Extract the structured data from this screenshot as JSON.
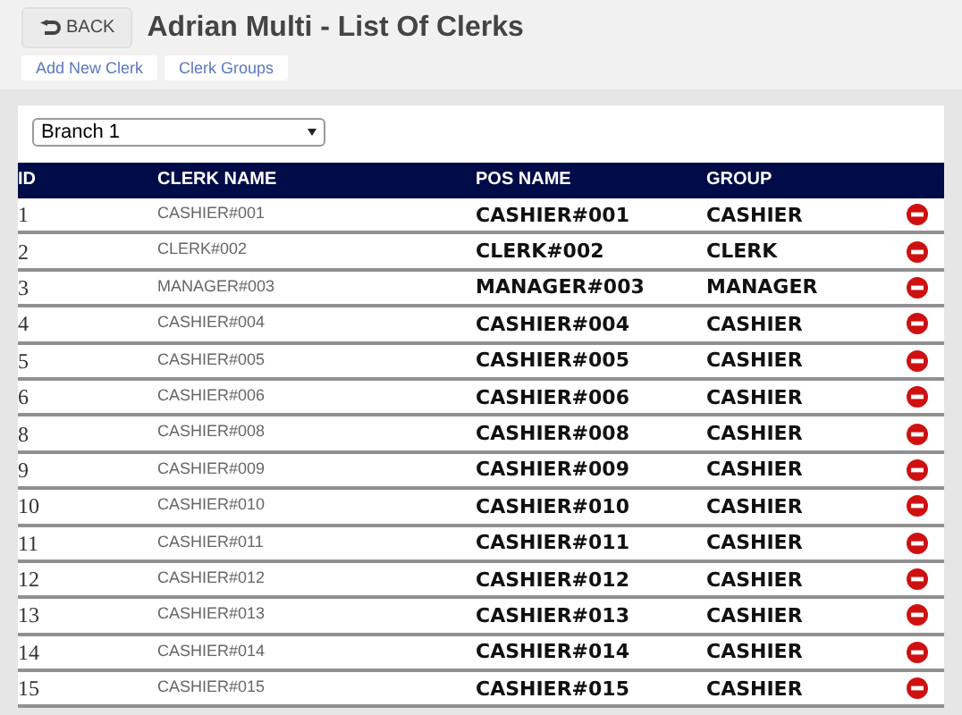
{
  "header": {
    "back_button": "BACK",
    "title": "Adrian Multi - List Of Clerks",
    "buttons": [
      "Add New Clerk",
      "Clerk Groups"
    ]
  },
  "branch_select": {
    "value": "Branch 1"
  },
  "table": {
    "columns": [
      "ID",
      "CLERK NAME",
      "POS NAME",
      "GROUP"
    ],
    "rows": [
      {
        "id": "1",
        "clerk_name": "CASHIER#001",
        "pos_name": "CASHIER#001",
        "group": "CASHIER"
      },
      {
        "id": "2",
        "clerk_name": "CLERK#002",
        "pos_name": "CLERK#002",
        "group": "CLERK"
      },
      {
        "id": "3",
        "clerk_name": "MANAGER#003",
        "pos_name": "MANAGER#003",
        "group": "MANAGER"
      },
      {
        "id": "4",
        "clerk_name": "CASHIER#004",
        "pos_name": "CASHIER#004",
        "group": "CASHIER"
      },
      {
        "id": "5",
        "clerk_name": "CASHIER#005",
        "pos_name": "CASHIER#005",
        "group": "CASHIER"
      },
      {
        "id": "6",
        "clerk_name": "CASHIER#006",
        "pos_name": "CASHIER#006",
        "group": "CASHIER"
      },
      {
        "id": "8",
        "clerk_name": "CASHIER#008",
        "pos_name": "CASHIER#008",
        "group": "CASHIER"
      },
      {
        "id": "9",
        "clerk_name": "CASHIER#009",
        "pos_name": "CASHIER#009",
        "group": "CASHIER"
      },
      {
        "id": "10",
        "clerk_name": "CASHIER#010",
        "pos_name": "CASHIER#010",
        "group": "CASHIER"
      },
      {
        "id": "11",
        "clerk_name": "CASHIER#011",
        "pos_name": "CASHIER#011",
        "group": "CASHIER"
      },
      {
        "id": "12",
        "clerk_name": "CASHIER#012",
        "pos_name": "CASHIER#012",
        "group": "CASHIER"
      },
      {
        "id": "13",
        "clerk_name": "CASHIER#013",
        "pos_name": "CASHIER#013",
        "group": "CASHIER"
      },
      {
        "id": "14",
        "clerk_name": "CASHIER#014",
        "pos_name": "CASHIER#014",
        "group": "CASHIER"
      },
      {
        "id": "15",
        "clerk_name": "CASHIER#015",
        "pos_name": "CASHIER#015",
        "group": "CASHIER"
      }
    ]
  }
}
